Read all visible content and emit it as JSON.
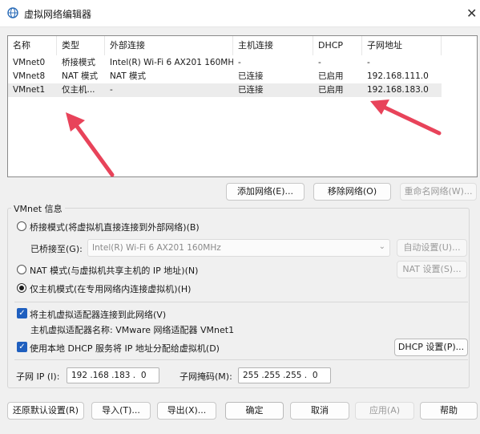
{
  "window": {
    "title": "虚拟网络编辑器",
    "close_glyph": "✕"
  },
  "table": {
    "columns": [
      "名称",
      "类型",
      "外部连接",
      "主机连接",
      "DHCP",
      "子网地址"
    ],
    "rows": [
      [
        "VMnet0",
        "桥接模式",
        "Intel(R) Wi-Fi 6 AX201 160MHz",
        "-",
        "-",
        "-"
      ],
      [
        "VMnet8",
        "NAT 模式",
        "NAT 模式",
        "已连接",
        "已启用",
        "192.168.111.0"
      ],
      [
        "VMnet1",
        "仅主机...",
        "-",
        "已连接",
        "已启用",
        "192.168.183.0"
      ]
    ],
    "selected_row": 2
  },
  "list_buttons": {
    "add": "添加网络(E)...",
    "remove": "移除网络(O)",
    "rename": "重命名网络(W)..."
  },
  "vmnet_info": {
    "group_label": "VMnet 信息",
    "bridge_radio": "桥接模式(将虚拟机直接连接到外部网络)(B)",
    "bridged_to_label": "已桥接至(G):",
    "bridged_to_value": "Intel(R) Wi-Fi 6 AX201 160MHz",
    "auto_settings": "自动设置(U)...",
    "nat_radio": "NAT 模式(与虚拟机共享主机的 IP 地址)(N)",
    "nat_settings": "NAT 设置(S)...",
    "hostonly_radio": "仅主机模式(在专用网络内连接虚拟机)(H)",
    "selected_mode": "hostonly",
    "connect_adapter": "将主机虚拟适配器连接到此网络(V)",
    "adapter_name_label": "主机虚拟适配器名称: VMware 网络适配器 VMnet1",
    "use_dhcp": "使用本地 DHCP 服务将 IP 地址分配给虚拟机(D)",
    "dhcp_settings": "DHCP 设置(P)...",
    "subnet_ip_label": "子网 IP (I):",
    "subnet_ip_value": "192 .168 .183 .  0",
    "subnet_mask_label": "子网掩码(M):",
    "subnet_mask_value": "255 .255 .255 .  0"
  },
  "footer": {
    "restore": "还原默认设置(R)",
    "import": "导入(T)...",
    "export": "导出(X)...",
    "ok": "确定",
    "cancel": "取消",
    "apply": "应用(A)",
    "help": "帮助"
  },
  "colors": {
    "accent": "#1f5fbf",
    "annotation_arrow": "#e8435a"
  }
}
